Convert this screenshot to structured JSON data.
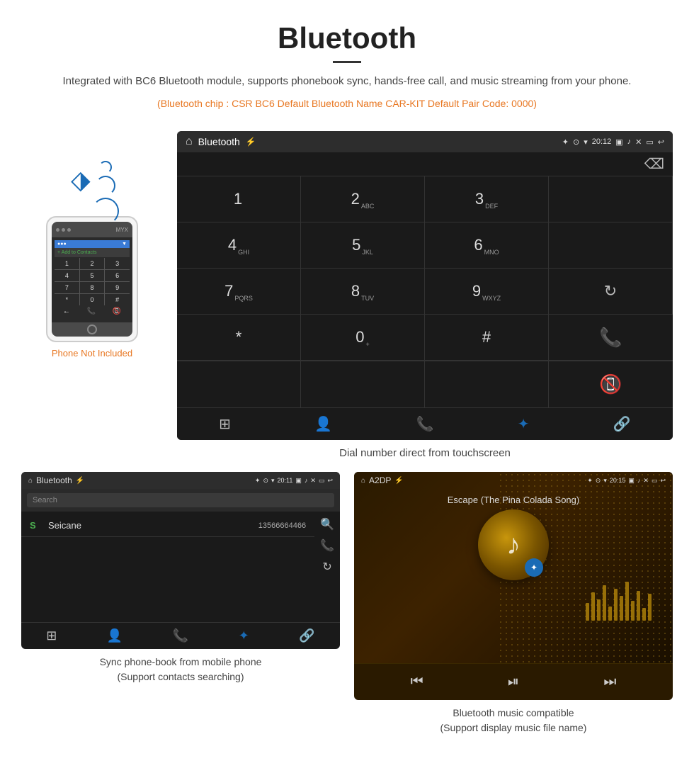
{
  "header": {
    "title": "Bluetooth",
    "description": "Integrated with BC6 Bluetooth module, supports phonebook sync, hands-free call, and music streaming from your phone.",
    "orange_info": "(Bluetooth chip : CSR BC6    Default Bluetooth Name CAR-KIT    Default Pair Code: 0000)"
  },
  "phone_illustration": {
    "not_included_label": "Phone Not Included",
    "add_contact_text": "+ Add to Contacts",
    "keys": [
      "1",
      "2",
      "3",
      "4",
      "5",
      "6",
      "7",
      "8",
      "9",
      "*",
      "0",
      "#"
    ]
  },
  "dial_screen": {
    "title": "Bluetooth",
    "time": "20:12",
    "keys": [
      {
        "main": "1",
        "sub": ""
      },
      {
        "main": "2",
        "sub": "ABC"
      },
      {
        "main": "3",
        "sub": "DEF"
      },
      {
        "main": "",
        "sub": ""
      },
      {
        "main": "4",
        "sub": "GHI"
      },
      {
        "main": "5",
        "sub": "JKL"
      },
      {
        "main": "6",
        "sub": "MNO"
      },
      {
        "main": "",
        "sub": ""
      },
      {
        "main": "7",
        "sub": "PQRS"
      },
      {
        "main": "8",
        "sub": "TUV"
      },
      {
        "main": "9",
        "sub": "WXYZ"
      },
      {
        "main": "↻",
        "sub": ""
      },
      {
        "main": "*",
        "sub": ""
      },
      {
        "main": "0",
        "sub": "+"
      },
      {
        "main": "#",
        "sub": ""
      },
      {
        "main": "call",
        "sub": ""
      },
      {
        "main": "end",
        "sub": ""
      }
    ],
    "caption": "Dial number direct from touchscreen"
  },
  "phonebook_screen": {
    "title": "Bluetooth",
    "time": "20:11",
    "search_placeholder": "Search",
    "contacts": [
      {
        "letter": "S",
        "name": "Seicane",
        "number": "13566664466"
      }
    ],
    "caption_line1": "Sync phone-book from mobile phone",
    "caption_line2": "(Support contacts searching)"
  },
  "music_screen": {
    "title": "A2DP",
    "time": "20:15",
    "song_title": "Escape (The Pina Colada Song)",
    "caption_line1": "Bluetooth music compatible",
    "caption_line2": "(Support display music file name)"
  },
  "icons": {
    "home": "⌂",
    "bluetooth": "✦",
    "back": "↩",
    "close": "✕",
    "menu": "▭",
    "camera": "📷",
    "volume": "🔊",
    "wifi": "▲",
    "battery": "▮",
    "usb": "⚡",
    "location": "●",
    "signal": "▲",
    "search": "🔍",
    "person": "👤",
    "phone": "📞",
    "refresh": "↻",
    "grid": "⊞",
    "link": "🔗",
    "backspace": "⌫",
    "prev": "⏮",
    "play_pause": "⏯",
    "next": "⏭",
    "music_note": "♪",
    "bt_icon": "✦"
  }
}
